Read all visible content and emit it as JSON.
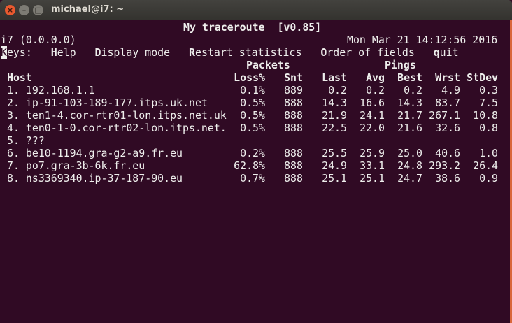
{
  "window": {
    "title": "michael@i7: ~",
    "buttons": [
      "close",
      "minimize",
      "maximize"
    ]
  },
  "app": {
    "title": "My traceroute  [v0.85]",
    "host": "i7 (0.0.0.0)",
    "datetime": "Mon Mar 21 14:12:56 2016"
  },
  "keys": {
    "label_key": "K",
    "label_rest": "eys:",
    "items": [
      {
        "key": "H",
        "rest": "elp"
      },
      {
        "key": "D",
        "rest": "isplay mode"
      },
      {
        "key": "R",
        "rest": "estart statistics"
      },
      {
        "key": "O",
        "rest": "rder of fields"
      },
      {
        "key": "q",
        "rest": "uit"
      }
    ]
  },
  "groups": {
    "packets": "Packets",
    "pings": "Pings"
  },
  "columns": [
    "Host",
    "Loss%",
    "Snt",
    "Last",
    "Avg",
    "Best",
    "Wrst",
    "StDev"
  ],
  "rows": [
    [
      "1. 192.168.1.1",
      "0.1%",
      "889",
      "0.2",
      "0.2",
      "0.2",
      "4.9",
      "0.3"
    ],
    [
      "2. ip-91-103-189-177.itps.uk.net",
      "0.5%",
      "888",
      "14.3",
      "16.6",
      "14.3",
      "83.7",
      "7.5"
    ],
    [
      "3. ten1-4.cor-rtr01-lon.itps.net.uk",
      "0.5%",
      "888",
      "21.9",
      "24.1",
      "21.7",
      "267.1",
      "10.8"
    ],
    [
      "4. ten0-1-0.cor-rtr02-lon.itps.net.",
      "0.5%",
      "888",
      "22.5",
      "22.0",
      "21.6",
      "32.6",
      "0.8"
    ],
    [
      "5. ???",
      "",
      "",
      "",
      "",
      "",
      "",
      ""
    ],
    [
      "6. be10-1194.gra-g2-a9.fr.eu",
      "0.2%",
      "888",
      "25.5",
      "25.9",
      "25.0",
      "40.6",
      "1.0"
    ],
    [
      "7. po7.gra-3b-6k.fr.eu",
      "62.8%",
      "888",
      "24.9",
      "33.1",
      "24.8",
      "293.2",
      "26.4"
    ],
    [
      "8. ns3369340.ip-37-187-90.eu",
      "0.7%",
      "888",
      "25.1",
      "25.1",
      "24.7",
      "38.6",
      "0.9"
    ]
  ],
  "colors": {
    "background": "#300a24",
    "text": "#eeeeec",
    "close": "#e9592f"
  }
}
